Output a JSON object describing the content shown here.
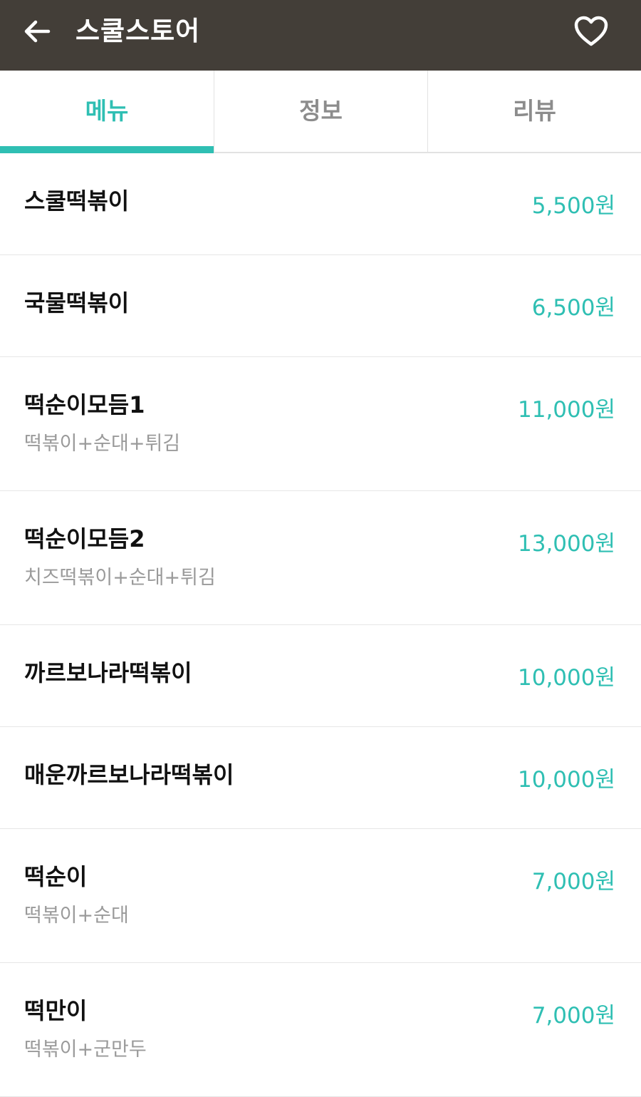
{
  "header": {
    "title": "스쿨스토어",
    "back_icon": "arrow-left-icon",
    "favorite_icon": "heart-outline-icon",
    "background_color": "#433e38"
  },
  "tabs": [
    {
      "label": "메뉴",
      "active": true
    },
    {
      "label": "정보",
      "active": false
    },
    {
      "label": "리뷰",
      "active": false
    }
  ],
  "accent_color": "#2fbfb3",
  "menu": [
    {
      "name": "스쿨떡볶이",
      "desc": "",
      "price": "5,500원"
    },
    {
      "name": "국물떡볶이",
      "desc": "",
      "price": "6,500원"
    },
    {
      "name": "떡순이모듬1",
      "desc": "떡볶이+순대+튀김",
      "price": "11,000원"
    },
    {
      "name": "떡순이모듬2",
      "desc": "치즈떡볶이+순대+튀김",
      "price": "13,000원"
    },
    {
      "name": "까르보나라떡볶이",
      "desc": "",
      "price": "10,000원"
    },
    {
      "name": "매운까르보나라떡볶이",
      "desc": "",
      "price": "10,000원"
    },
    {
      "name": "떡순이",
      "desc": "떡볶이+순대",
      "price": "7,000원"
    },
    {
      "name": "떡만이",
      "desc": "떡볶이+군만두",
      "price": "7,000원"
    }
  ]
}
